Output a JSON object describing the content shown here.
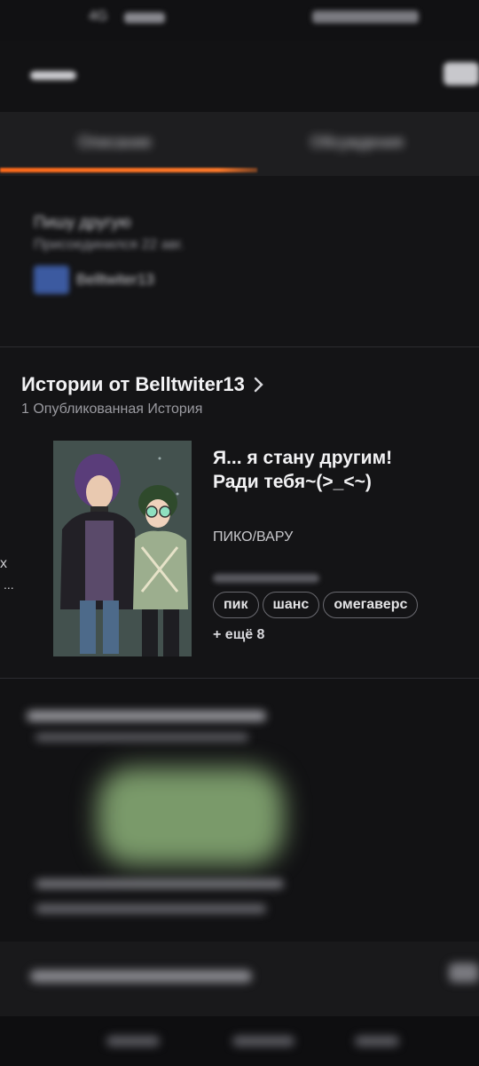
{
  "status_bar": {
    "network": "4G",
    "right_text": ""
  },
  "tabs": {
    "left_label": "Описание",
    "right_label": "Обсуждения"
  },
  "story_info": {
    "line1": "Пишу другую",
    "line2": "Присоединился 22 авг.",
    "author_name": "Belltwiter13"
  },
  "author_stories": {
    "heading": "Истории от Belltwiter13",
    "subheading": "1 Опубликованная История",
    "side_fragment_1": "х",
    "side_fragment_2": "...",
    "story": {
      "title_line1": "Я... я стану другим!",
      "title_line2": "Ради тебя~(>_<~)",
      "fandom": "ПИКО/ВАРУ",
      "tags": [
        "пик",
        "шанс",
        "омегаверс"
      ],
      "more_tags": "+ ещё 8"
    }
  },
  "colors": {
    "accent": "#ff6a1a",
    "background": "#141416",
    "text": "#e8e8ea",
    "muted": "#9a9aa0"
  }
}
